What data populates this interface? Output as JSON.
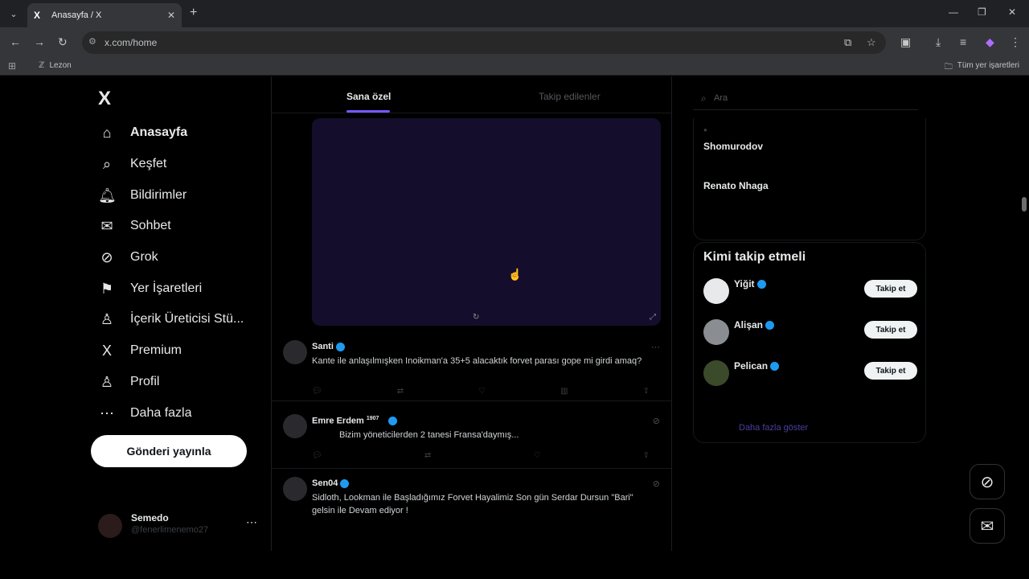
{
  "browser": {
    "tab_title": "Anasayfa / X",
    "tab_favicon": "X",
    "url": "x.com/home",
    "bookmark": "Lezon",
    "all_bookmarks": "Tüm yer işaretleri"
  },
  "sidebar": {
    "logo": "X",
    "items": [
      {
        "label": "Anasayfa",
        "icon": "home-icon",
        "glyph": "⌂"
      },
      {
        "label": "Keşfet",
        "icon": "search-icon",
        "glyph": "⌕"
      },
      {
        "label": "Bildirimler",
        "icon": "bell-icon",
        "glyph": "🔔︎"
      },
      {
        "label": "Sohbet",
        "icon": "mail-icon",
        "glyph": "✉"
      },
      {
        "label": "Grok",
        "icon": "grok-icon",
        "glyph": "⊘"
      },
      {
        "label": "Yer İşaretleri",
        "icon": "bookmark-icon",
        "glyph": "⚑"
      },
      {
        "label": "İçerik Üreticisi Stü...",
        "icon": "creator-studio-icon",
        "glyph": "♙"
      },
      {
        "label": "Premium",
        "icon": "premium-x-icon",
        "glyph": "X"
      },
      {
        "label": "Profil",
        "icon": "profile-icon",
        "glyph": "♙"
      },
      {
        "label": "Daha fazla",
        "icon": "more-icon",
        "glyph": "⋯"
      }
    ],
    "post_button": "Gönderi yayınla",
    "profile": {
      "name": "Semedo",
      "handle": "@fenerlimenemo27"
    }
  },
  "feed": {
    "tabs": [
      "Sana özel",
      "Takip edilenler"
    ],
    "posts": [
      {
        "author": "Santi",
        "text": "Kante ile anlaşılmışken Inoikman'a 35+5 alacaktık forvet parası gope mi girdi amaq?"
      },
      {
        "author": "Emre Erdem",
        "author_suffix": "1907",
        "text": "Bizim yöneticilerden 2 tanesi Fransa'daymış..."
      },
      {
        "author": "Sen04",
        "text": "Sidloth, Lookman ile Başladığımız Forvet Hayalimiz Son gün Serdar Dursun \"Bari\" gelsin ile Devam ediyor !"
      }
    ]
  },
  "right": {
    "search_placeholder": "Ara",
    "trends": [
      "Shomurodov",
      "Renato Nhaga"
    ],
    "follow_title": "Kimi takip etmeli",
    "follow_button": "Takip et",
    "suggestions": [
      {
        "name": "Yiğit"
      },
      {
        "name": "Alişan"
      },
      {
        "name": "Pelican"
      }
    ],
    "show_more": "Daha fazla göster"
  }
}
